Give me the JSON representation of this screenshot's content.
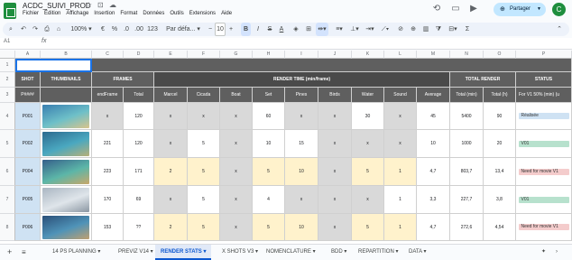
{
  "app": {
    "title": "ACDC_SUIVI_PROD",
    "star_icon": "star-icon",
    "menu": [
      "Fichier",
      "Édition",
      "Affichage",
      "Insertion",
      "Format",
      "Données",
      "Outils",
      "Extensions",
      "Aide"
    ],
    "share_label": "Partager",
    "avatar_letter": "C"
  },
  "toolbar": {
    "zoom": "100%",
    "font": "Par défa...",
    "font_size": "10"
  },
  "formula_bar": {
    "cell_ref": "A1",
    "fx": "fx"
  },
  "columns": [
    "A",
    "B",
    "C",
    "D",
    "E",
    "F",
    "G",
    "H",
    "I",
    "J",
    "K",
    "L",
    "M",
    "N",
    "O",
    "P"
  ],
  "headers": {
    "shot": "SHOT",
    "thumbnails": "THUMBNAILS",
    "frames": "FRAMES",
    "render_time": "RENDER TIME (min/frame)",
    "total_render": "TOTAL RENDER",
    "status": "STATUS",
    "sub_shot": "P####",
    "sub_frames": [
      "endFrame",
      "Total"
    ],
    "sub_render": [
      "Marcel",
      "Cicada",
      "Boat",
      "Set",
      "Pines",
      "Birds",
      "Water",
      "Sound",
      "Average"
    ],
    "sub_total": [
      "Total (min)",
      "Total (h)"
    ],
    "sub_status": "For V1 50% (min) (u"
  },
  "rows": [
    {
      "row": "1",
      "cells": []
    },
    {
      "row": "2",
      "cells": []
    },
    {
      "row": "3",
      "cells": []
    },
    {
      "row": "4",
      "shot": "P001",
      "end": "x",
      "total": "120",
      "render": [
        "x",
        "x",
        "x",
        "60",
        "x",
        "x",
        "30",
        "x"
      ],
      "avg": "45",
      "tmin": "5400",
      "th": "90",
      "status": "Réalisée"
    },
    {
      "row": "5",
      "shot": "P002",
      "end": "221",
      "total": "120",
      "render": [
        "x",
        "5",
        "x",
        "10",
        "15",
        "x",
        "x",
        "x"
      ],
      "avg": "10",
      "tmin": "1000",
      "th": "20",
      "status": "V01"
    },
    {
      "row": "6",
      "shot": "P004",
      "end": "223",
      "total": "171",
      "render": [
        "2",
        "5",
        "x",
        "5",
        "10",
        "x",
        "5",
        "1"
      ],
      "avg": "4,7",
      "tmin": "803,7",
      "th": "13,4",
      "status": "Need for movie V1"
    },
    {
      "row": "7",
      "shot": "P005",
      "end": "170",
      "total": "69",
      "render": [
        "x",
        "5",
        "x",
        "4",
        "x",
        "x",
        "x",
        "1"
      ],
      "avg": "3,3",
      "tmin": "227,7",
      "th": "3,8",
      "status": "V01"
    },
    {
      "row": "8",
      "shot": "P006",
      "end": "153",
      "total": "??",
      "render": [
        "2",
        "5",
        "x",
        "5",
        "10",
        "x",
        "5",
        "1"
      ],
      "avg": "4,7",
      "tmin": "272,6",
      "th": "4,54",
      "status": "Need for movie V1"
    }
  ],
  "sheets": [
    "14 PS PLANNING",
    "PREVIZ V14",
    "RENDER STATS",
    "X SHOTS V3",
    "NOMENCLATURE",
    "BDD",
    "REPARTITION",
    "DATA"
  ],
  "active_sheet": "RENDER STATS",
  "colors": {
    "header_dark": "#5f5f5f",
    "shot_blue": "#cfe2f3",
    "cream": "#fff2cc",
    "gray_cell": "#d9d9d9",
    "status_green": "#b7e1cd",
    "status_red": "#f4cccc",
    "status_blue": "#cfe2f3"
  }
}
